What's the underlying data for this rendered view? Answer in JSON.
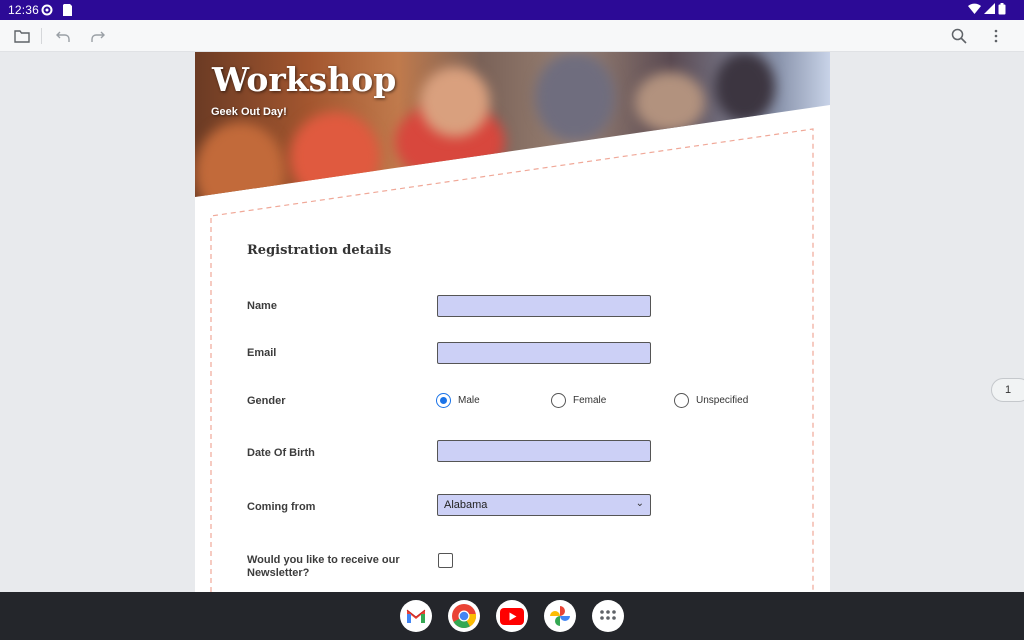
{
  "status_bar": {
    "time": "12:36"
  },
  "toolbar": {
    "icons": [
      "folder-icon",
      "undo-icon",
      "redo-icon",
      "search-icon",
      "more-vert-icon"
    ]
  },
  "banner": {
    "title": "Workshop",
    "subtitle": "Geek Out Day!"
  },
  "form": {
    "section_title": "Registration details",
    "name_label": "Name",
    "name_value": "",
    "email_label": "Email",
    "email_value": "",
    "gender_label": "Gender",
    "gender_options": [
      "Male",
      "Female",
      "Unspecified"
    ],
    "gender_selected": "Male",
    "dob_label": "Date Of Birth",
    "dob_value": "",
    "coming_from_label": "Coming from",
    "coming_from_value": "Alabama",
    "newsletter_label": "Would you like to receive our Newsletter?",
    "newsletter_checked": false
  },
  "page_indicator": "1",
  "colors": {
    "status_bar": "#2c0a96",
    "field_fill": "#ccd0f6",
    "radio_accent": "#1a73e8",
    "dashed_border": "#f0a898"
  },
  "navbar": {
    "apps": [
      "gmail-icon",
      "chrome-icon",
      "youtube-icon",
      "photos-icon",
      "app-drawer-icon"
    ]
  }
}
